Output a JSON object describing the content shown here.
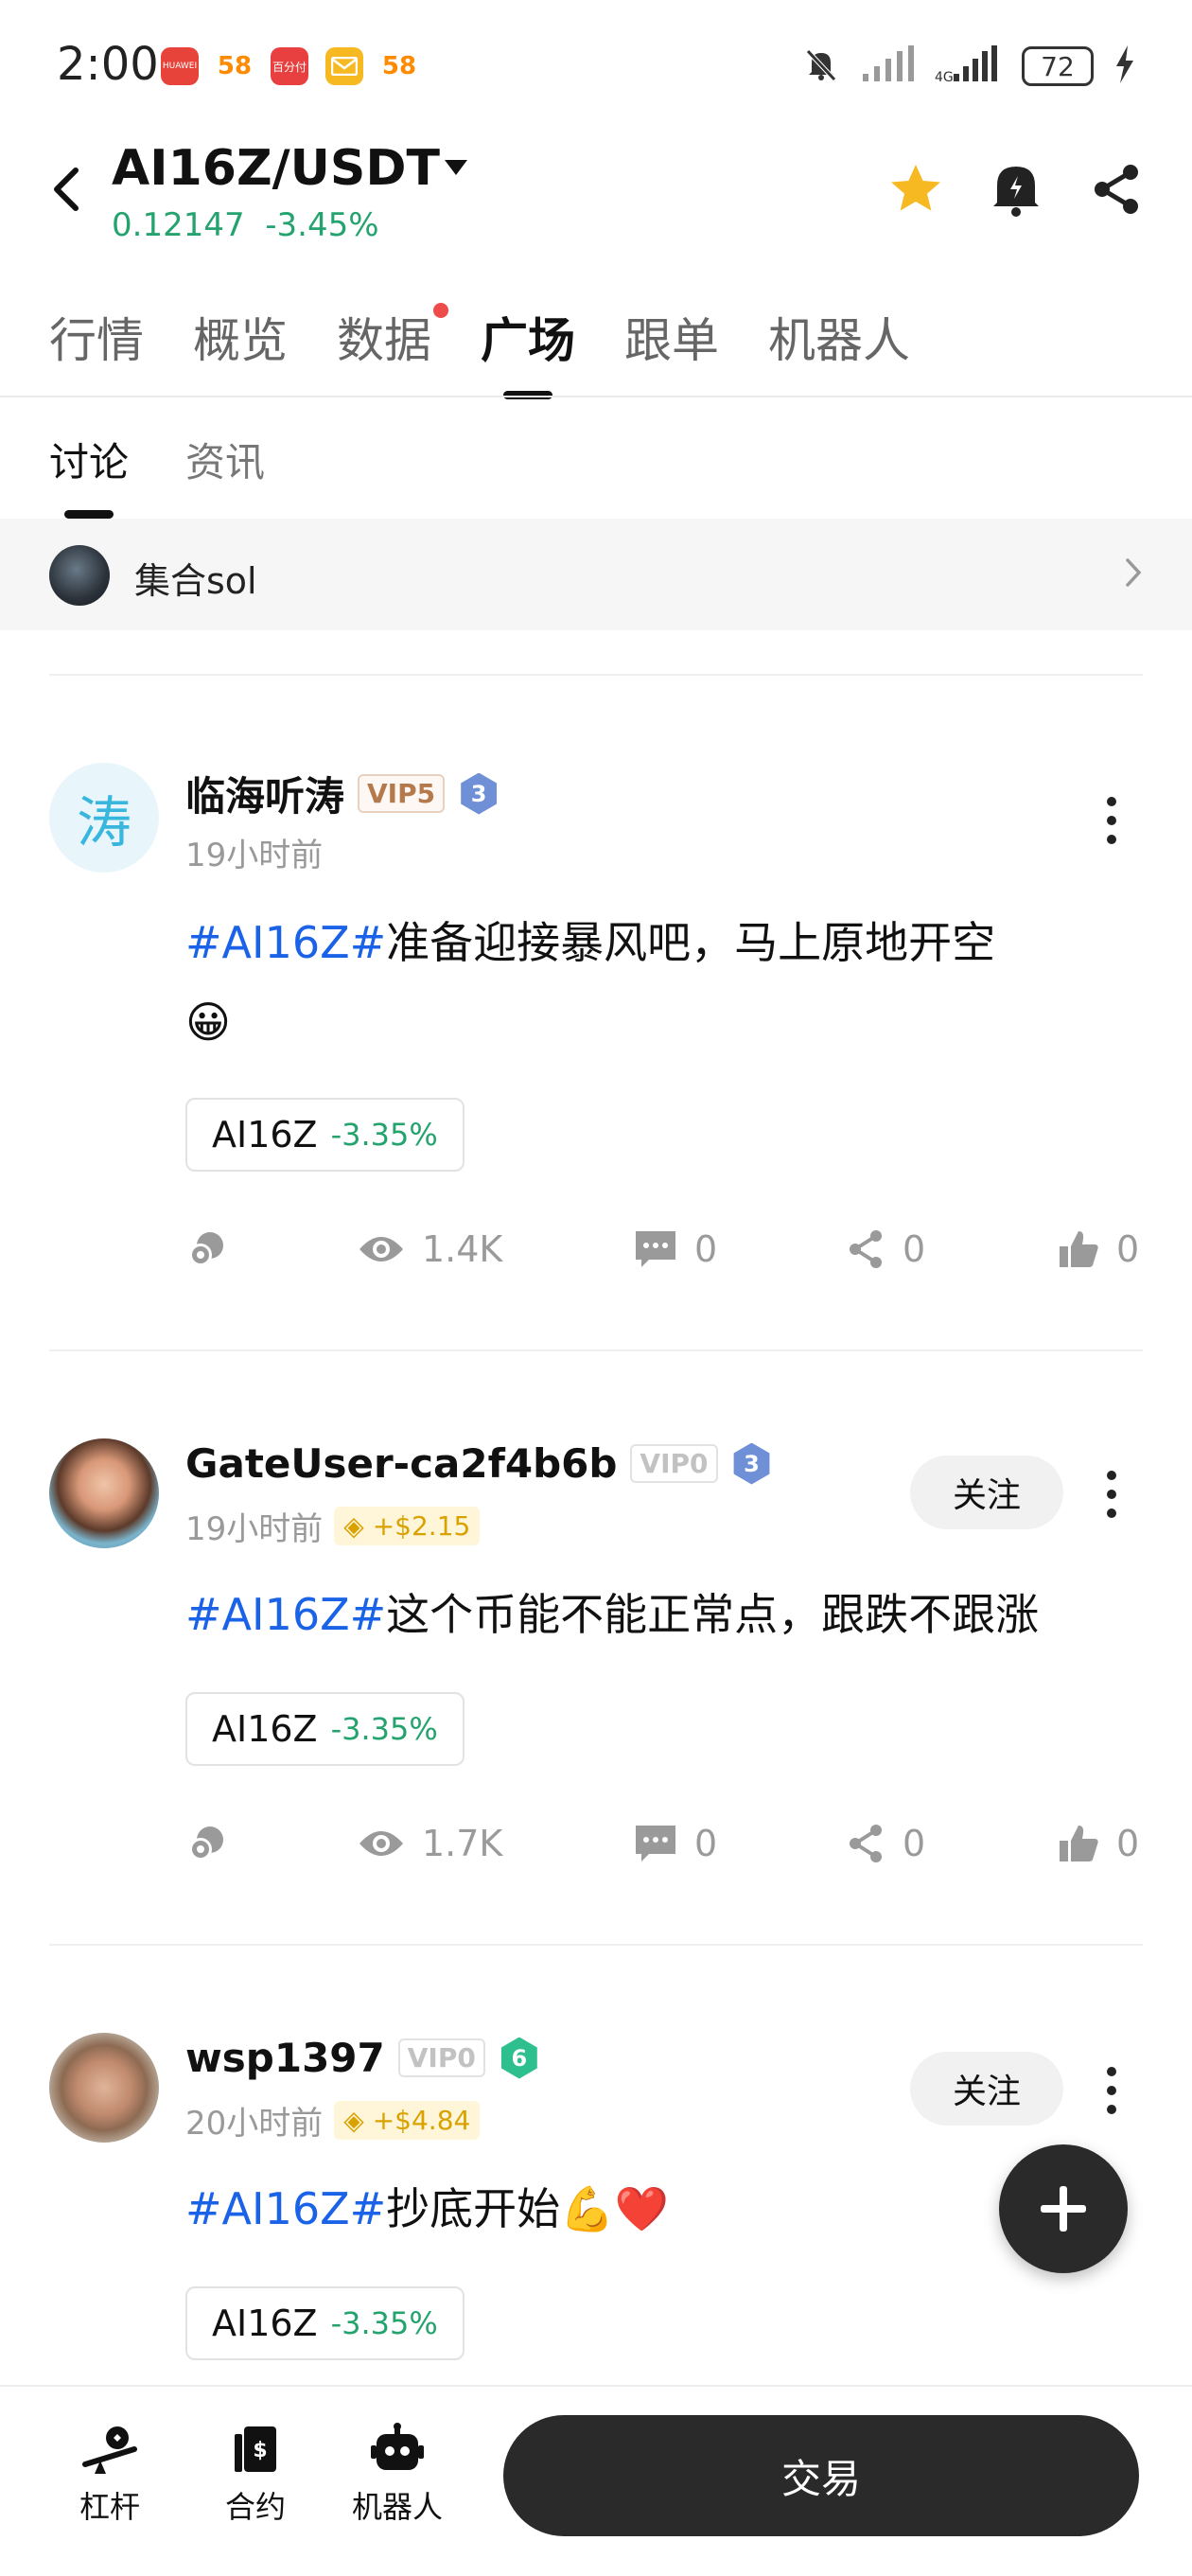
{
  "status_bar": {
    "time": "2:00",
    "apps": [
      {
        "icon": "huawei-icon",
        "label": "HUAWEI",
        "color": "#e8433a"
      },
      {
        "icon": "58-icon",
        "label": "58",
        "color": "#ff8a00"
      },
      {
        "icon": "pay-icon",
        "label": "百分付",
        "color": "#e84040"
      },
      {
        "icon": "mail-icon",
        "label": "",
        "color": "#f6b921"
      },
      {
        "icon": "58-icon",
        "label": "58",
        "color": "#ff8a00"
      }
    ],
    "battery": "72"
  },
  "header": {
    "pair": "AI16Z/USDT",
    "price": "0.12147",
    "change": "-3.45%",
    "icons": [
      "star-icon",
      "bell-icon",
      "share-icon"
    ]
  },
  "main_tabs": [
    {
      "label": "行情"
    },
    {
      "label": "概览"
    },
    {
      "label": "数据",
      "dot": true
    },
    {
      "label": "广场",
      "active": true
    },
    {
      "label": "跟单"
    },
    {
      "label": "机器人"
    }
  ],
  "sub_tabs": [
    {
      "label": "讨论",
      "active": true
    },
    {
      "label": "资讯"
    }
  ],
  "banner": {
    "label": "集合sol"
  },
  "posts": [
    {
      "avatar_char": "涛",
      "username": "临海听涛",
      "vip": "VIP5",
      "level": "3",
      "time": "19小时前",
      "profit": "",
      "hashtag": "#AI16Z#",
      "text": "准备迎接暴风吧，马上原地开空",
      "emoji": "😀",
      "token": {
        "symbol": "AI16Z",
        "change": "-3.35%"
      },
      "stats": {
        "views": "1.4K",
        "comments": "0",
        "shares": "0",
        "likes": "0"
      }
    },
    {
      "username": "GateUser-ca2f4b6b",
      "vip": "VIP0",
      "level": "3",
      "time": "19小时前",
      "profit": "+$2.15",
      "follow": "关注",
      "hashtag": "#AI16Z#",
      "text": "这个币能不能正常点，跟跌不跟涨",
      "token": {
        "symbol": "AI16Z",
        "change": "-3.35%"
      },
      "stats": {
        "views": "1.7K",
        "comments": "0",
        "shares": "0",
        "likes": "0"
      }
    },
    {
      "username": "wsp1397",
      "vip": "VIP0",
      "level": "6",
      "time": "20小时前",
      "profit": "+$4.84",
      "follow": "关注",
      "hashtag": "#AI16Z#",
      "text": "抄底开始💪❤️",
      "token": {
        "symbol": "AI16Z",
        "change": "-3.35%"
      }
    }
  ],
  "fab": {
    "label": "+"
  },
  "bottom_nav": [
    {
      "label": "杠杆",
      "icon": "leverage-icon"
    },
    {
      "label": "合约",
      "icon": "contract-icon"
    },
    {
      "label": "机器人",
      "icon": "robot-icon"
    }
  ],
  "trade_button": "交易"
}
